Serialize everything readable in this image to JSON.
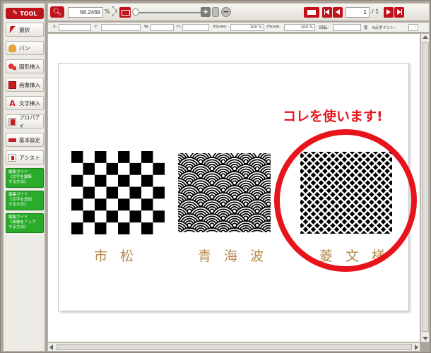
{
  "sidebar": {
    "header": "TOOL",
    "items": [
      {
        "label": "選択",
        "icon": "cursor-arrow-icon"
      },
      {
        "label": "パン",
        "icon": "hand-icon"
      },
      {
        "label": "図形挿入",
        "icon": "shape-icon"
      },
      {
        "label": "画像挿入",
        "icon": "image-icon"
      },
      {
        "label": "文字挿入",
        "icon": "text-icon"
      },
      {
        "label": "プロパティ",
        "icon": "properties-icon"
      },
      {
        "label": "基本設定",
        "icon": "settings-icon"
      },
      {
        "label": "アシスト",
        "icon": "assist-icon"
      }
    ],
    "guides": [
      {
        "lines": [
          "編集ガイド",
          "《文字を編集",
          "する方法》"
        ]
      },
      {
        "lines": [
          "編集ガイド",
          "《文字を追加",
          "する方法》"
        ]
      },
      {
        "lines": [
          "編集ガイド",
          "《画像をアップ",
          "する方法》"
        ]
      }
    ]
  },
  "toolbar": {
    "zoom_value": "68.2469",
    "zoom_unit": "%",
    "zoom_in": "+",
    "zoom_out": "−",
    "current_page": "1",
    "total_pages": "/ 1"
  },
  "propbar": {
    "x_label": "X:",
    "y_label": "Y:",
    "w_label": "W:",
    "h_label": "H:",
    "xscale_label": "XScale:",
    "xscale_value": "100 %",
    "yscale_label": "YScale:",
    "yscale_value": "100 %",
    "rotate_label": "回転:",
    "unit_label": "度",
    "points_label": "9点ポイント:",
    "points_value": ":"
  },
  "canvas": {
    "callout": "コレを使います!",
    "patterns": [
      {
        "name": "市松",
        "type": "checkerboard"
      },
      {
        "name": "青海波",
        "type": "seigaiha"
      },
      {
        "name": "菱文様",
        "type": "hishi"
      }
    ]
  },
  "colors": {
    "accent_red": "#c0121b",
    "callout_red": "#e8141c",
    "guide_green": "#2aab2a",
    "label_gold": "#b88a4e"
  }
}
